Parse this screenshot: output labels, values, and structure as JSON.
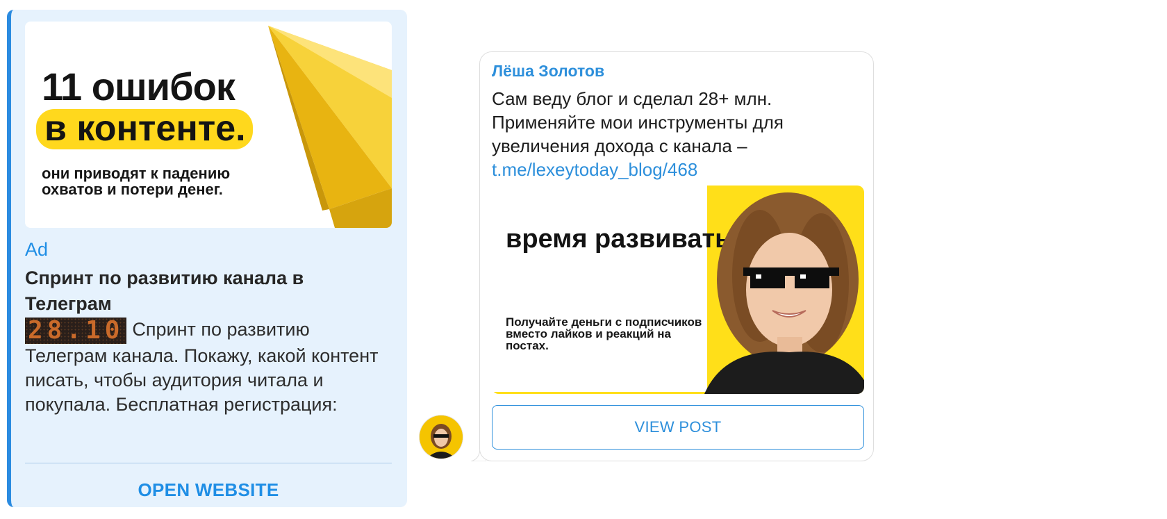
{
  "ad": {
    "banner": {
      "headline": "11 ошибок",
      "headline_highlight": "в контенте.",
      "subtitle": "они приводят к падению охватов и потери денег."
    },
    "label": "Ad",
    "title": "Спринт по развитию канала в Телеграм",
    "date_badge": "28.10",
    "body": "Спринт по развитию Телеграм канала. Покажу, какой контент писать, чтобы аудитория читала и покупала. Бесплатная регистрация:",
    "button_label": "OPEN WEBSITE"
  },
  "post": {
    "author": "Лёша Золотов",
    "text": "Сам веду блог и сделал 28+ млн. Применяйте мои инструменты для увеличения дохода с канала –",
    "link": "t.me/lexeytoday_blog/468",
    "image": {
      "headline": "время развивать канал!",
      "subtitle": "Получайте деньги с подписчиков вместо лайков и реакций на постах."
    },
    "button_label": "VIEW POST"
  },
  "colors": {
    "accent": "#2d8fdb",
    "ad_background": "#e6f2fd",
    "brand_yellow": "#ffdf19"
  }
}
